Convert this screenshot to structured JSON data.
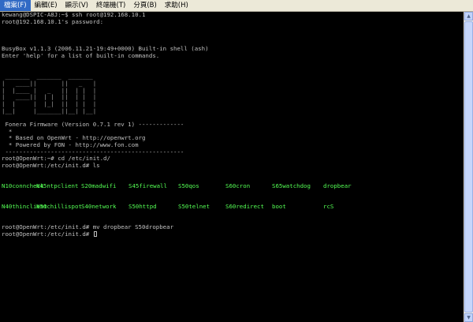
{
  "menu": [
    "檔案(F)",
    "編輯(E)",
    "顯示(V)",
    "終端機(T)",
    "分頁(B)",
    "求助(H)"
  ],
  "terminal": {
    "l1": "kewang@DSPIC-A8J:~$ ssh root@192.168.10.1",
    "l2": "root@192.168.10.1's password:",
    "l3": "BusyBox v1.1.3 (2006.11.21-19:49+0000) Built-in shell (ash)",
    "l4": "Enter 'help' for a list of built-in commands.",
    "logo": [
      " _______  _______  _______",
      "|   ____||       ||   _   |",
      "|  |____ |   _   ||  | |  |",
      "|   ____||  | |  ||  | |  |",
      "|  |     |  |_|  ||  | |  |",
      "|__|     |_______||__| |__|"
    ],
    "l5": " Fonera Firmware (Version 0.7.1 rev 1) -------------",
    "l6": "  *",
    "l7": "  * Based on OpenWrt - http://openwrt.org",
    "l8": "  * Powered by FON - http://www.fon.com",
    "l9": " ---------------------------------------------------",
    "l10": "root@OpenWrt:~# cd /etc/init.d/",
    "l11": "root@OpenWrt:/etc/init.d# ls",
    "ls_row1": [
      "N10conncheck",
      "N45ntpclient",
      "S20madwifi",
      "S45firewall",
      "S50qos",
      "S60cron",
      "S65watchdog",
      "dropbear"
    ],
    "ls_row2": [
      "N40thinclient",
      "N50chillispot",
      "S40network",
      "S50httpd",
      "S50telnet",
      "S60redirect",
      "boot",
      "rcS"
    ],
    "l12": "root@OpenWrt:/etc/init.d# mv dropbear S50dropbear",
    "l13": "root@OpenWrt:/etc/init.d# "
  },
  "colors": {
    "terminal_bg": "#000000",
    "terminal_fg": "#c0c0c0",
    "ls_executable": "#54ff54"
  }
}
